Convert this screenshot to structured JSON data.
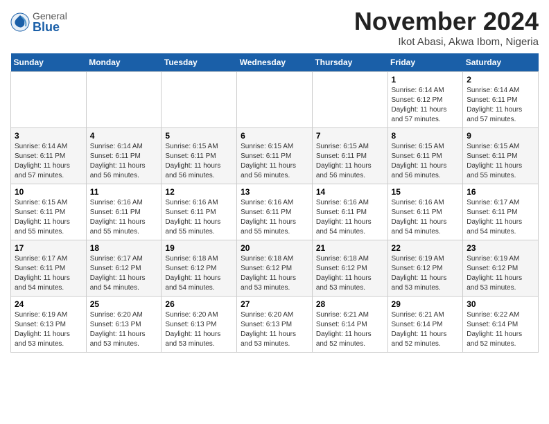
{
  "logo": {
    "general": "General",
    "blue": "Blue"
  },
  "title": "November 2024",
  "subtitle": "Ikot Abasi, Akwa Ibom, Nigeria",
  "weekdays": [
    "Sunday",
    "Monday",
    "Tuesday",
    "Wednesday",
    "Thursday",
    "Friday",
    "Saturday"
  ],
  "weeks": [
    [
      {
        "day": "",
        "info": ""
      },
      {
        "day": "",
        "info": ""
      },
      {
        "day": "",
        "info": ""
      },
      {
        "day": "",
        "info": ""
      },
      {
        "day": "",
        "info": ""
      },
      {
        "day": "1",
        "info": "Sunrise: 6:14 AM\nSunset: 6:12 PM\nDaylight: 11 hours\nand 57 minutes."
      },
      {
        "day": "2",
        "info": "Sunrise: 6:14 AM\nSunset: 6:11 PM\nDaylight: 11 hours\nand 57 minutes."
      }
    ],
    [
      {
        "day": "3",
        "info": "Sunrise: 6:14 AM\nSunset: 6:11 PM\nDaylight: 11 hours\nand 57 minutes."
      },
      {
        "day": "4",
        "info": "Sunrise: 6:14 AM\nSunset: 6:11 PM\nDaylight: 11 hours\nand 56 minutes."
      },
      {
        "day": "5",
        "info": "Sunrise: 6:15 AM\nSunset: 6:11 PM\nDaylight: 11 hours\nand 56 minutes."
      },
      {
        "day": "6",
        "info": "Sunrise: 6:15 AM\nSunset: 6:11 PM\nDaylight: 11 hours\nand 56 minutes."
      },
      {
        "day": "7",
        "info": "Sunrise: 6:15 AM\nSunset: 6:11 PM\nDaylight: 11 hours\nand 56 minutes."
      },
      {
        "day": "8",
        "info": "Sunrise: 6:15 AM\nSunset: 6:11 PM\nDaylight: 11 hours\nand 56 minutes."
      },
      {
        "day": "9",
        "info": "Sunrise: 6:15 AM\nSunset: 6:11 PM\nDaylight: 11 hours\nand 55 minutes."
      }
    ],
    [
      {
        "day": "10",
        "info": "Sunrise: 6:15 AM\nSunset: 6:11 PM\nDaylight: 11 hours\nand 55 minutes."
      },
      {
        "day": "11",
        "info": "Sunrise: 6:16 AM\nSunset: 6:11 PM\nDaylight: 11 hours\nand 55 minutes."
      },
      {
        "day": "12",
        "info": "Sunrise: 6:16 AM\nSunset: 6:11 PM\nDaylight: 11 hours\nand 55 minutes."
      },
      {
        "day": "13",
        "info": "Sunrise: 6:16 AM\nSunset: 6:11 PM\nDaylight: 11 hours\nand 55 minutes."
      },
      {
        "day": "14",
        "info": "Sunrise: 6:16 AM\nSunset: 6:11 PM\nDaylight: 11 hours\nand 54 minutes."
      },
      {
        "day": "15",
        "info": "Sunrise: 6:16 AM\nSunset: 6:11 PM\nDaylight: 11 hours\nand 54 minutes."
      },
      {
        "day": "16",
        "info": "Sunrise: 6:17 AM\nSunset: 6:11 PM\nDaylight: 11 hours\nand 54 minutes."
      }
    ],
    [
      {
        "day": "17",
        "info": "Sunrise: 6:17 AM\nSunset: 6:11 PM\nDaylight: 11 hours\nand 54 minutes."
      },
      {
        "day": "18",
        "info": "Sunrise: 6:17 AM\nSunset: 6:12 PM\nDaylight: 11 hours\nand 54 minutes."
      },
      {
        "day": "19",
        "info": "Sunrise: 6:18 AM\nSunset: 6:12 PM\nDaylight: 11 hours\nand 54 minutes."
      },
      {
        "day": "20",
        "info": "Sunrise: 6:18 AM\nSunset: 6:12 PM\nDaylight: 11 hours\nand 53 minutes."
      },
      {
        "day": "21",
        "info": "Sunrise: 6:18 AM\nSunset: 6:12 PM\nDaylight: 11 hours\nand 53 minutes."
      },
      {
        "day": "22",
        "info": "Sunrise: 6:19 AM\nSunset: 6:12 PM\nDaylight: 11 hours\nand 53 minutes."
      },
      {
        "day": "23",
        "info": "Sunrise: 6:19 AM\nSunset: 6:12 PM\nDaylight: 11 hours\nand 53 minutes."
      }
    ],
    [
      {
        "day": "24",
        "info": "Sunrise: 6:19 AM\nSunset: 6:13 PM\nDaylight: 11 hours\nand 53 minutes."
      },
      {
        "day": "25",
        "info": "Sunrise: 6:20 AM\nSunset: 6:13 PM\nDaylight: 11 hours\nand 53 minutes."
      },
      {
        "day": "26",
        "info": "Sunrise: 6:20 AM\nSunset: 6:13 PM\nDaylight: 11 hours\nand 53 minutes."
      },
      {
        "day": "27",
        "info": "Sunrise: 6:20 AM\nSunset: 6:13 PM\nDaylight: 11 hours\nand 53 minutes."
      },
      {
        "day": "28",
        "info": "Sunrise: 6:21 AM\nSunset: 6:14 PM\nDaylight: 11 hours\nand 52 minutes."
      },
      {
        "day": "29",
        "info": "Sunrise: 6:21 AM\nSunset: 6:14 PM\nDaylight: 11 hours\nand 52 minutes."
      },
      {
        "day": "30",
        "info": "Sunrise: 6:22 AM\nSunset: 6:14 PM\nDaylight: 11 hours\nand 52 minutes."
      }
    ]
  ]
}
